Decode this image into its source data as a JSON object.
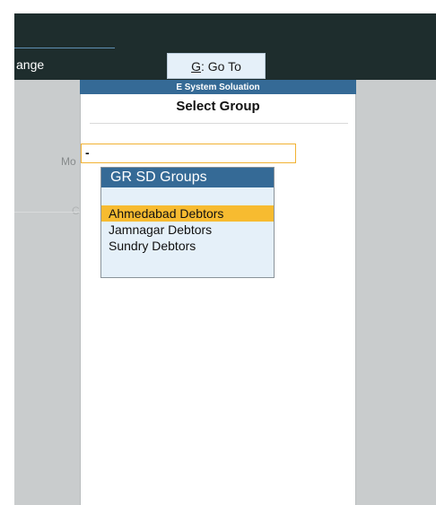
{
  "navbar": {
    "change_label": "ange",
    "goto_key": "G",
    "goto_label": ": Go To"
  },
  "company": "E System Soluation",
  "background": {
    "mo_label": "Mo",
    "c_label": "C"
  },
  "dialog": {
    "title": "Select Group",
    "input_value": "-",
    "list_header": "GR SD Groups",
    "items": [
      {
        "label": "Ahmedabad Debtors",
        "selected": true
      },
      {
        "label": "Jamnagar Debtors",
        "selected": false
      },
      {
        "label": "Sundry Debtors",
        "selected": false
      }
    ]
  },
  "colors": {
    "title_bar": "#1e2d2d",
    "accent_blue": "#356a96",
    "list_bg": "#e5f0f9",
    "highlight": "#f7bb30",
    "input_border": "#f2b233"
  }
}
